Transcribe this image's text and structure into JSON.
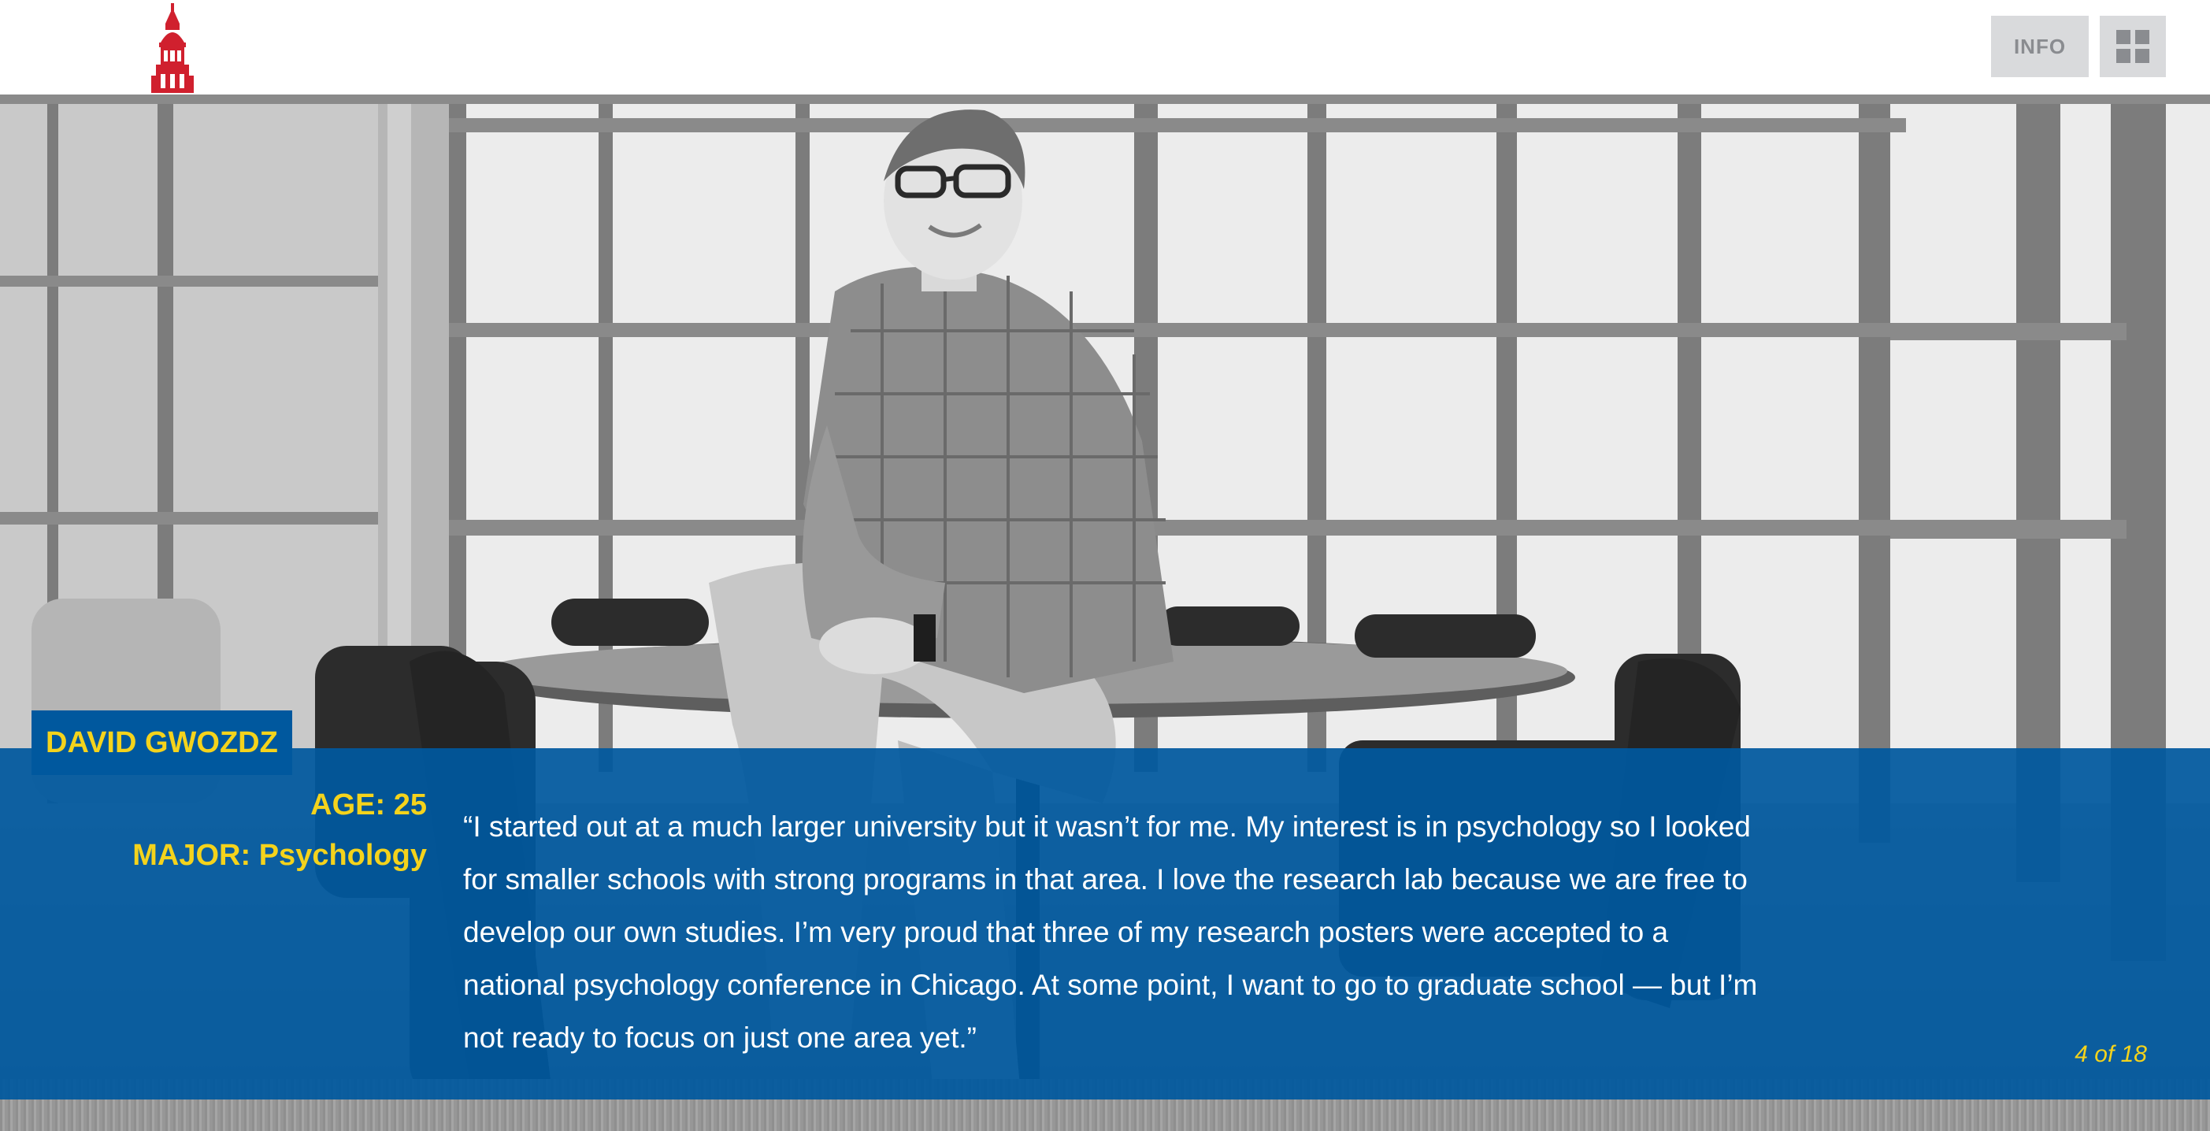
{
  "header": {
    "info_label": "INFO"
  },
  "profile": {
    "name": "DAVID GWOZDZ",
    "age": "AGE: 25",
    "major": "MAJOR: Psychology",
    "quote": "“I started out at a much larger university but it wasn’t for me. My interest is in psychology so I looked for smaller schools with strong programs in that area. I love the research lab because we are free to develop our own studies. I’m very proud that three of my research posters were accepted to a national psychology conference in Chicago. At some point, I want to go to graduate school — but I’m not ready to focus on just one area yet.”"
  },
  "pager": {
    "label": "4 of 18"
  },
  "colors": {
    "band_blue": "#00589e",
    "accent_yellow": "#f4d31c",
    "logo_red": "#d0202e",
    "button_gray": "#d9dadc"
  },
  "icons": {
    "logo": "clock-tower-logo",
    "grid": "grid-view-icon"
  }
}
